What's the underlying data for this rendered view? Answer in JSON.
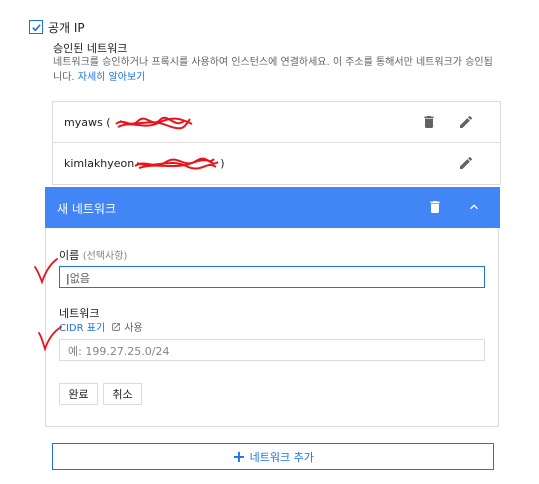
{
  "public_ip": {
    "label": "공개 IP",
    "checked": true
  },
  "authorized": {
    "title": "승인된 네트워크",
    "description": "네트워크를 승인하거나 프록시를 사용하여 인스턴스에 연결하세요. 이 주소를 통해서만 네트워크가 승인됩니다.",
    "learn_more": "자세히 알아보기"
  },
  "networks": [
    {
      "name_prefix": "myaws (",
      "name_suffix": ""
    },
    {
      "name_prefix": "kimlakhyeon",
      "name_suffix": ")"
    }
  ],
  "new_network": {
    "title": "새 네트워크",
    "name_label": "이름",
    "name_optional": "(선택사항)",
    "name_value": "없음",
    "network_label": "네트워크",
    "cidr_link": "CIDR 표기",
    "usage": "사용",
    "network_placeholder": "예: 199.27.25.0/24",
    "done_label": "완료",
    "cancel_label": "취소"
  },
  "add_network_label": "네트워크 추가",
  "icons": {
    "trash": "trash-icon",
    "edit": "edit-icon",
    "collapse": "chevron-up-icon",
    "external": "external-link-icon"
  },
  "colors": {
    "accent": "#1a73e8",
    "header": "#4285f4",
    "annotation": "#e8141c"
  }
}
